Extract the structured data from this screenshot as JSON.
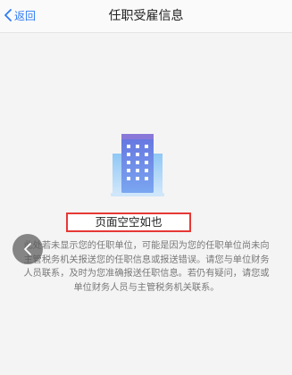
{
  "navbar": {
    "back_label": "返回",
    "title": "任职受雇信息"
  },
  "empty_state": {
    "title": "页面空空如也",
    "description": "此处若未显示您的任职单位，可能是因为您的任职单位尚未向主管税务机关报送您的任职信息或报送错误。请您与单位财务人员联系，及时为您准确报送任职信息。若仍有疑问，请您或单位财务人员与主管税务机关联系。"
  },
  "colors": {
    "accent": "#2f7bf5",
    "highlight_border": "#e53935",
    "building": "#6f86e8"
  },
  "icons": {
    "back": "chevron-left-icon",
    "illustration": "building-icon",
    "floating": "chevron-left-icon"
  }
}
